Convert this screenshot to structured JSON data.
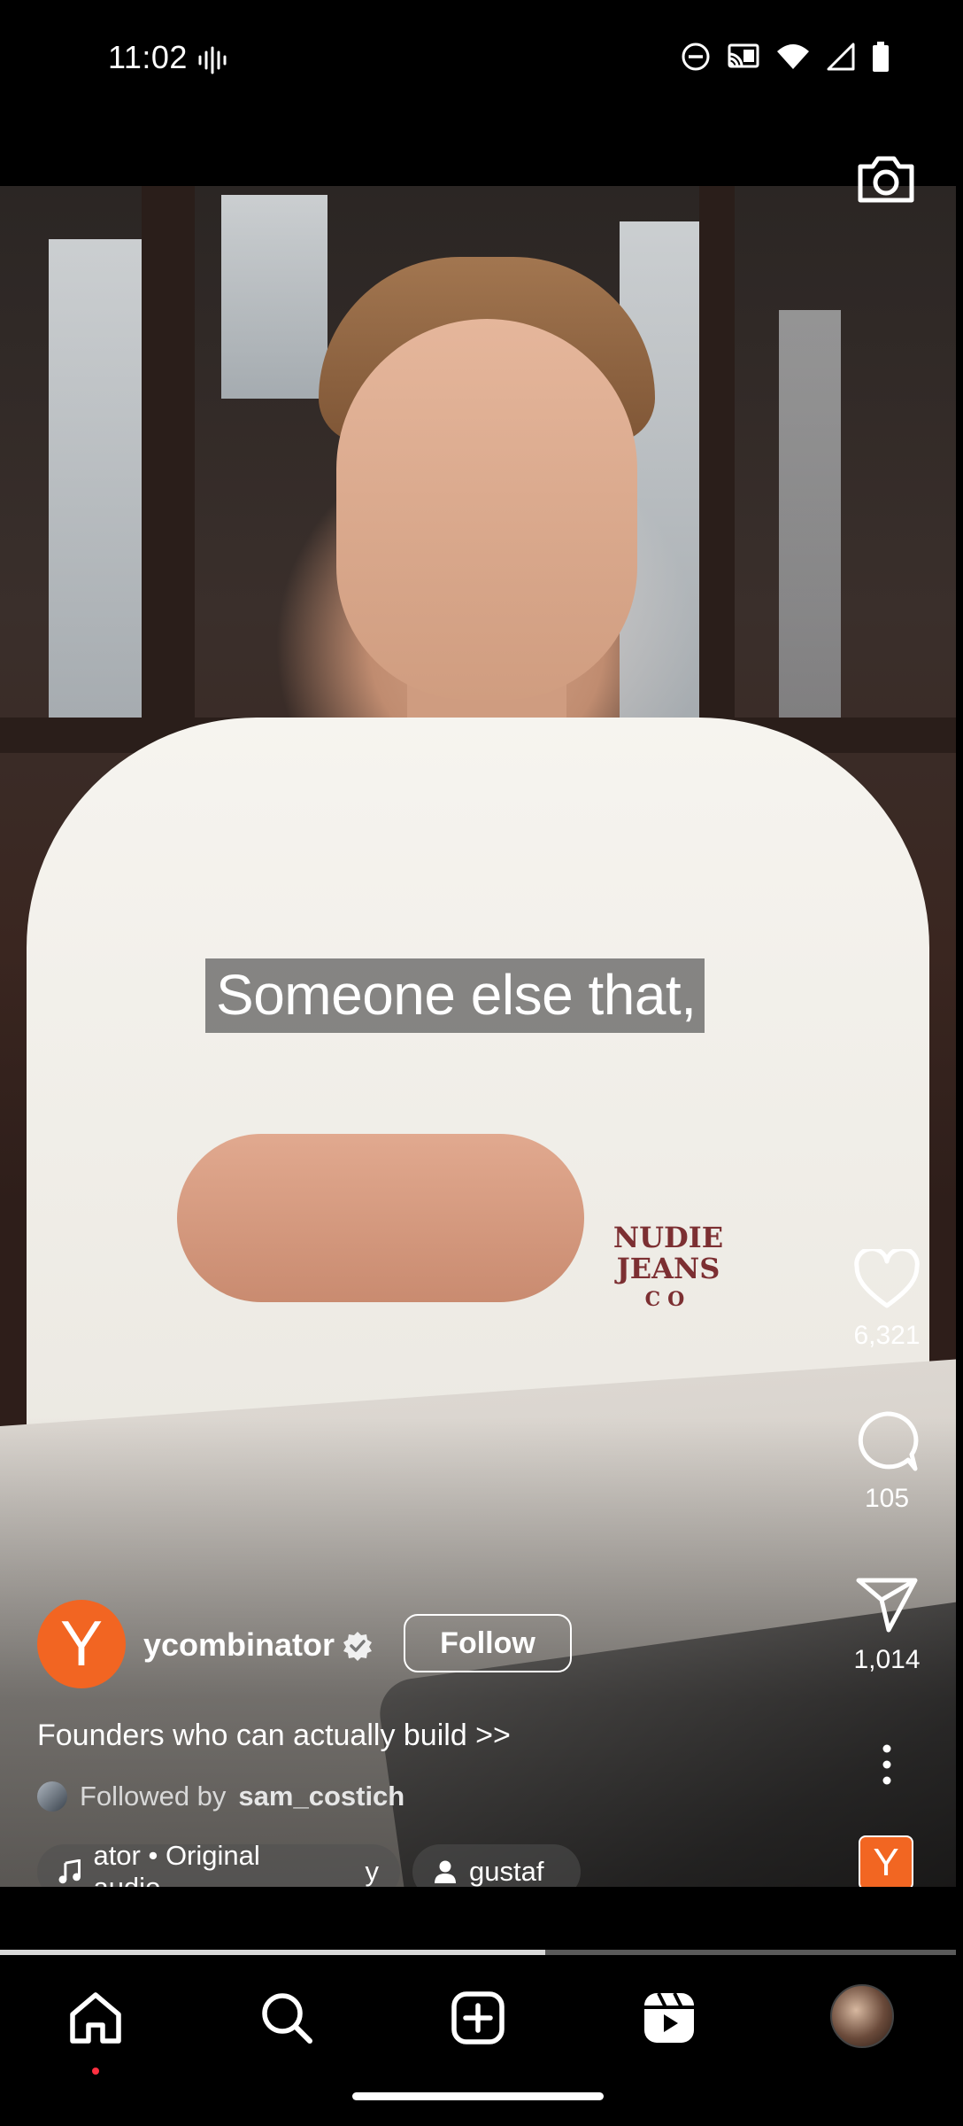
{
  "status_bar": {
    "time": "11:02"
  },
  "video": {
    "caption": "Someone else that,",
    "shirt_logo": [
      "NUDIE",
      "JEANS",
      "CO"
    ]
  },
  "actions": {
    "likes": "6,321",
    "comments": "105",
    "shares": "1,014"
  },
  "author": {
    "avatar_letter": "Y",
    "username": "ycombinator",
    "verified": true,
    "follow_label": "Follow",
    "description": "Founders who can actually build >>",
    "followed_by_prefix": "Followed by",
    "followed_by_user": "sam_costich"
  },
  "chips": {
    "audio": "ator • Original audio",
    "audio_trail": "y",
    "people": "gustaf"
  },
  "audio_thumb_letter": "Y",
  "progress": {
    "fraction": 0.57
  },
  "colors": {
    "brand": "#f26522",
    "notification_dot": "#ff3040"
  },
  "nav": [
    "home",
    "search",
    "create",
    "reels",
    "profile"
  ]
}
